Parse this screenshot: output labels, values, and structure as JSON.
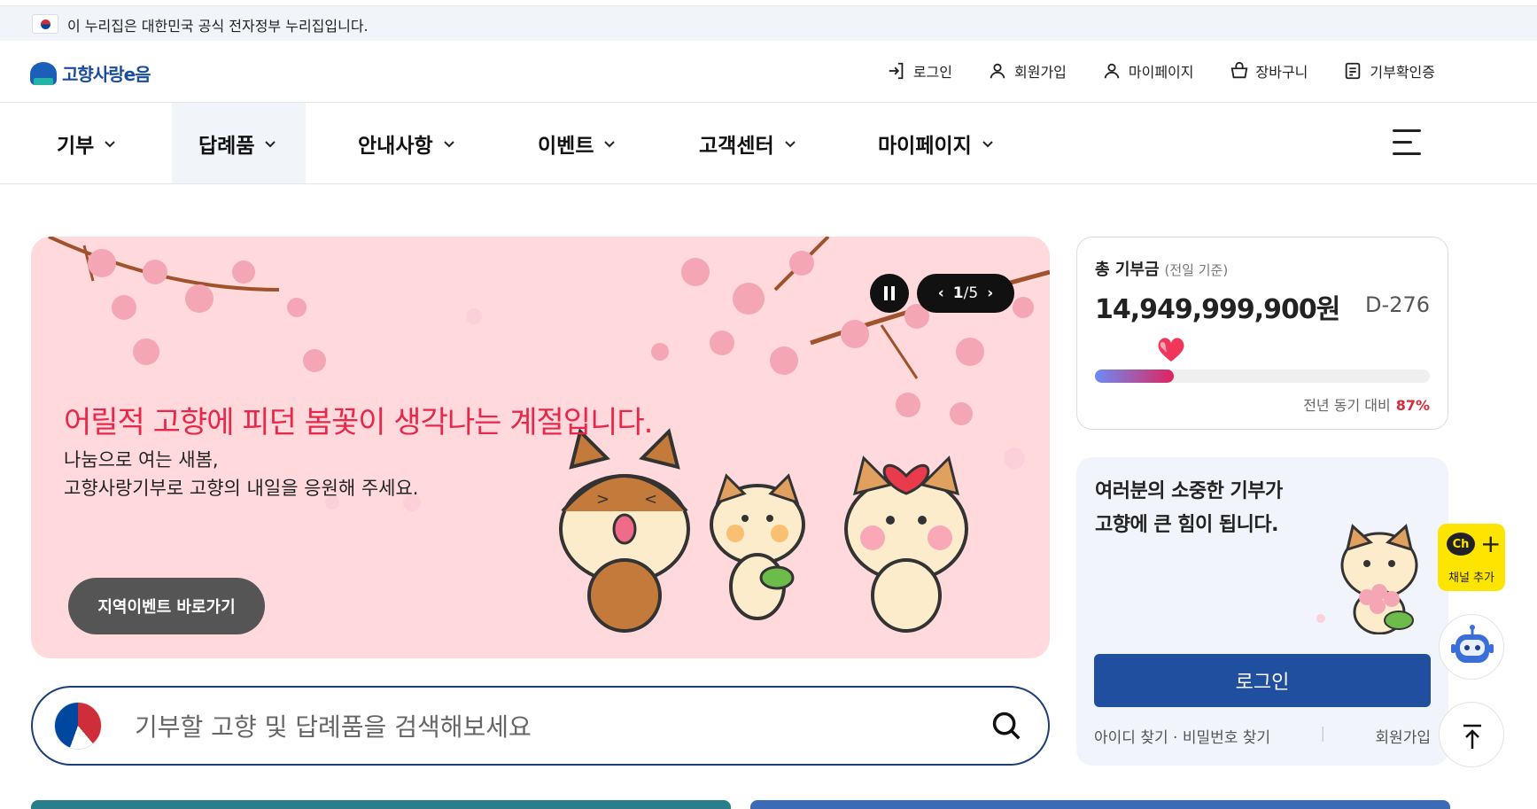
{
  "gov_bar": {
    "text": "이 누리집은 대한민국 공식 전자정부 누리집입니다."
  },
  "header": {
    "logo_text": "고향사랑e음",
    "util": [
      {
        "label": "로그인",
        "icon": "login-icon"
      },
      {
        "label": "회원가입",
        "icon": "user-icon"
      },
      {
        "label": "마이페이지",
        "icon": "user-icon"
      },
      {
        "label": "장바구니",
        "icon": "basket-icon"
      },
      {
        "label": "기부확인증",
        "icon": "certificate-icon"
      }
    ]
  },
  "gnb": {
    "items": [
      {
        "label": "기부",
        "active": false
      },
      {
        "label": "답례품",
        "active": true
      },
      {
        "label": "안내사항",
        "active": false
      },
      {
        "label": "이벤트",
        "active": false
      },
      {
        "label": "고객센터",
        "active": false
      },
      {
        "label": "마이페이지",
        "active": false
      }
    ]
  },
  "banner": {
    "title": "어릴적 고향에 피던 봄꽃이 생각나는 계절입니다.",
    "sub1": "나눔으로 여는 새봄,",
    "sub2": "고향사랑기부로 고향의 내일을 응원해 주세요.",
    "button": "지역이벤트 바로가기",
    "pager_current": "1",
    "pager_total": "/5",
    "bg_color": "#ffd9dc",
    "title_color": "#e8284a"
  },
  "search": {
    "placeholder": "기부할 고향 및 답례품을 검색해보세요"
  },
  "stats": {
    "label": "총 기부금",
    "label_note": "(전일 기준)",
    "amount": "14,949,999,900원",
    "dday": "D-276",
    "progress": 0.235,
    "compare_label": "전년 동기 대비",
    "compare_value": "87%"
  },
  "login_card": {
    "line1": "여러분의 소중한 기부가",
    "line2": "고향에 큰 힘이 됩니다.",
    "button": "로그인",
    "find": "아이디 찾기 · 비밀번호 찾기",
    "join": "회원가입"
  },
  "floating": {
    "kakao_label": "채널 추가",
    "kakao_ch": "Ch",
    "kakao_plus": "+"
  },
  "colors": {
    "primary": "#1f4f9e",
    "accent_red": "#d62b3a"
  }
}
